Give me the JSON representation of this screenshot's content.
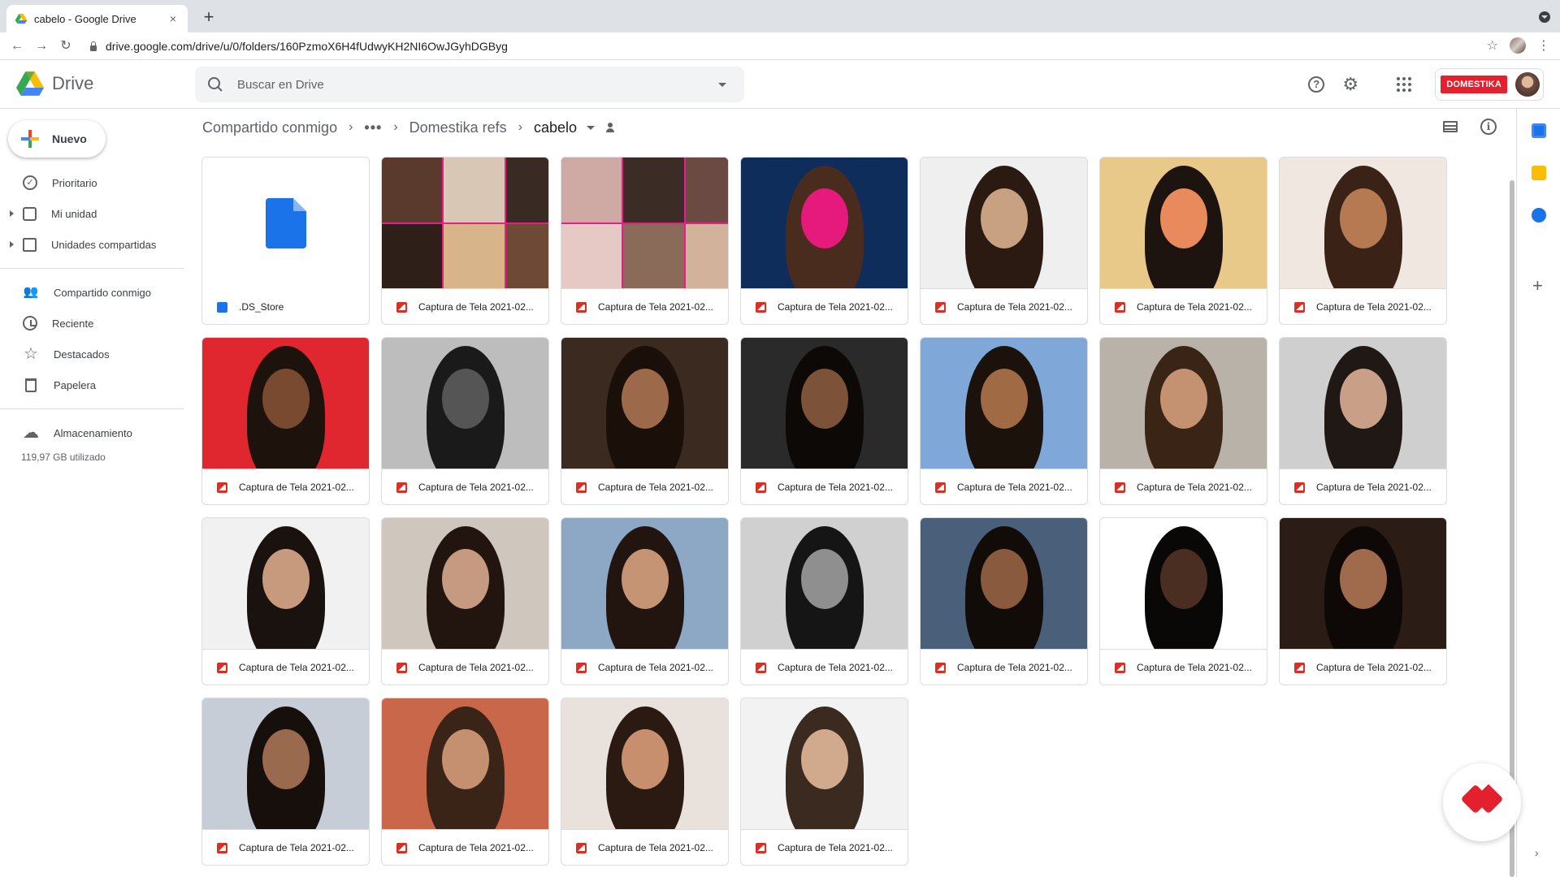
{
  "browser": {
    "tab_title": "cabelo - Google Drive",
    "close_glyph": "×",
    "new_tab_glyph": "+",
    "url": "drive.google.com/drive/u/0/folders/160PzmoX6H4fUdwyKH2NI6OwJGyhDGByg",
    "back_glyph": "←",
    "forward_glyph": "→",
    "reload_glyph": "↻",
    "star_glyph": "☆",
    "kebab_glyph": "⋮"
  },
  "header": {
    "app_name": "Drive",
    "search_placeholder": "Buscar en Drive",
    "help_glyph": "?",
    "gear_glyph": "⚙",
    "brand_badge": "DOMESTIKA"
  },
  "sidebar": {
    "new_label": "Nuevo",
    "items": [
      {
        "label": "Prioritario",
        "icon": "check-circle-icon"
      },
      {
        "label": "Mi unidad",
        "icon": "drive-icon"
      },
      {
        "label": "Unidades compartidas",
        "icon": "shared-drives-icon"
      },
      {
        "label": "Compartido conmigo",
        "icon": "people-icon"
      },
      {
        "label": "Reciente",
        "icon": "clock-icon"
      },
      {
        "label": "Destacados",
        "icon": "star-icon"
      },
      {
        "label": "Papelera",
        "icon": "trash-icon"
      },
      {
        "label": "Almacenamiento",
        "icon": "cloud-icon"
      }
    ],
    "check_glyph": "✓",
    "star_glyph": "☆",
    "cloud_glyph": "☁",
    "people_glyph": "👥",
    "storage_used": "119,97 GB utilizado"
  },
  "breadcrumb": {
    "root": "Compartido conmigo",
    "more": "•••",
    "folder": "Domestika refs",
    "current": "cabelo",
    "sep": "›",
    "info_glyph": "i"
  },
  "files": [
    {
      "name": ".DS_Store",
      "type": "doc"
    },
    {
      "name": "Captura de Tela 2021-02...",
      "type": "image"
    },
    {
      "name": "Captura de Tela 2021-02...",
      "type": "image"
    },
    {
      "name": "Captura de Tela 2021-02...",
      "type": "image"
    },
    {
      "name": "Captura de Tela 2021-02...",
      "type": "image"
    },
    {
      "name": "Captura de Tela 2021-02...",
      "type": "image"
    },
    {
      "name": "Captura de Tela 2021-02...",
      "type": "image"
    },
    {
      "name": "Captura de Tela 2021-02...",
      "type": "image"
    },
    {
      "name": "Captura de Tela 2021-02...",
      "type": "image"
    },
    {
      "name": "Captura de Tela 2021-02...",
      "type": "image"
    },
    {
      "name": "Captura de Tela 2021-02...",
      "type": "image"
    },
    {
      "name": "Captura de Tela 2021-02...",
      "type": "image"
    },
    {
      "name": "Captura de Tela 2021-02...",
      "type": "image"
    },
    {
      "name": "Captura de Tela 2021-02...",
      "type": "image"
    },
    {
      "name": "Captura de Tela 2021-02...",
      "type": "image"
    },
    {
      "name": "Captura de Tela 2021-02...",
      "type": "image"
    },
    {
      "name": "Captura de Tela 2021-02...",
      "type": "image"
    },
    {
      "name": "Captura de Tela 2021-02...",
      "type": "image"
    },
    {
      "name": "Captura de Tela 2021-02...",
      "type": "image"
    },
    {
      "name": "Captura de Tela 2021-02...",
      "type": "image"
    },
    {
      "name": "Captura de Tela 2021-02...",
      "type": "image"
    },
    {
      "name": "Captura de Tela 2021-02...",
      "type": "image"
    },
    {
      "name": "Captura de Tela 2021-02...",
      "type": "image"
    },
    {
      "name": "Captura de Tela 2021-02...",
      "type": "image"
    },
    {
      "name": "Captura de Tela 2021-02...",
      "type": "image"
    }
  ],
  "rail": {
    "plus_glyph": "+",
    "chevron_glyph": "›"
  },
  "colors": {
    "accent_blue": "#1a73e8",
    "image_icon_red": "#d93025",
    "brand_red": "#e5202e"
  }
}
